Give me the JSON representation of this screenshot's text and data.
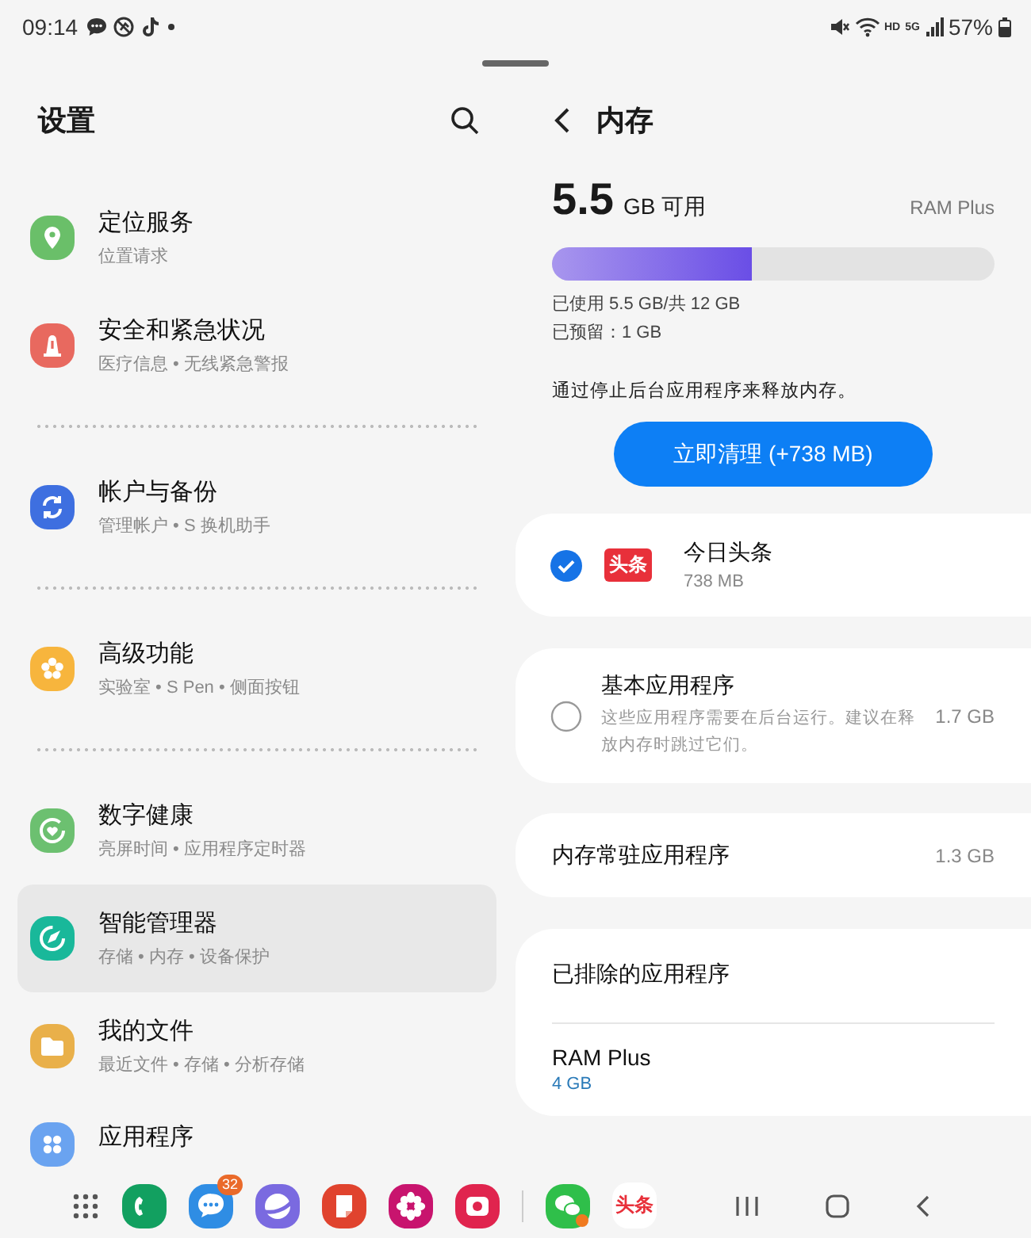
{
  "status_bar": {
    "time": "09:14",
    "indicators": [
      "HD",
      "5G"
    ],
    "battery": "57%"
  },
  "settings": {
    "title": "设置",
    "groups": [
      [
        {
          "kind": "location",
          "color": "#6abf69",
          "title": "定位服务",
          "subtitle": "位置请求",
          "selected": false
        },
        {
          "kind": "safety",
          "color": "#e8695f",
          "title": "安全和紧急状况",
          "subtitle": "医疗信息 • 无线紧急警报",
          "selected": false
        }
      ],
      [
        {
          "kind": "accounts",
          "color": "#3e6fe0",
          "title": "帐户与备份",
          "subtitle": "管理帐户 • S 换机助手",
          "selected": false
        }
      ],
      [
        {
          "kind": "advanced",
          "color": "#f7b53d",
          "title": "高级功能",
          "subtitle": "实验室 • S Pen • 侧面按钮",
          "selected": false
        }
      ],
      [
        {
          "kind": "wellbeing",
          "color": "#6cc070",
          "title": "数字健康",
          "subtitle": "亮屏时间 • 应用程序定时器",
          "selected": false
        },
        {
          "kind": "care",
          "color": "#19b89a",
          "title": "智能管理器",
          "subtitle": "存储 • 内存 • 设备保护",
          "selected": true
        },
        {
          "kind": "files",
          "color": "#e9b04a",
          "title": "我的文件",
          "subtitle": "最近文件 • 存储 • 分析存储",
          "selected": false
        },
        {
          "kind": "apps",
          "color": "#6aa3f0",
          "title": "应用程序",
          "selected": false
        }
      ]
    ]
  },
  "memory": {
    "title": "内存",
    "available_value": "5.5",
    "available_unit": "GB 可用",
    "ram_plus": "RAM Plus",
    "usage": {
      "level": 0.45
    },
    "used": "已使用 5.5 GB/共 12 GB",
    "reserved": "已预留：1 GB",
    "hint": "通过停止后台应用程序来释放内存。",
    "clean_button": "立即清理 (+738 MB)",
    "cards": [
      {
        "kind": "app",
        "checked": true,
        "logo": "头条",
        "name": "今日头条",
        "size": "738 MB"
      },
      {
        "kind": "option",
        "checked": false,
        "name": "基本应用程序",
        "description": "这些应用程序需要在后台运行。建议在释放内存时跳过它们。",
        "size": "1.7 GB"
      },
      {
        "kind": "link",
        "name": "内存常驻应用程序",
        "size": "1.3 GB"
      },
      {
        "kind": "group",
        "rows": [
          {
            "name": "已排除的应用程序"
          },
          {
            "name": "RAM Plus",
            "value": "4 GB"
          }
        ]
      }
    ]
  },
  "dock": {
    "apps": [
      {
        "kind": "phone"
      },
      {
        "kind": "messages",
        "badge": "32"
      },
      {
        "kind": "browser"
      },
      {
        "kind": "notes"
      },
      {
        "kind": "flower"
      },
      {
        "kind": "camera"
      },
      {
        "kind": "divider"
      },
      {
        "kind": "chat"
      },
      {
        "kind": "news",
        "label": "头条"
      }
    ]
  }
}
